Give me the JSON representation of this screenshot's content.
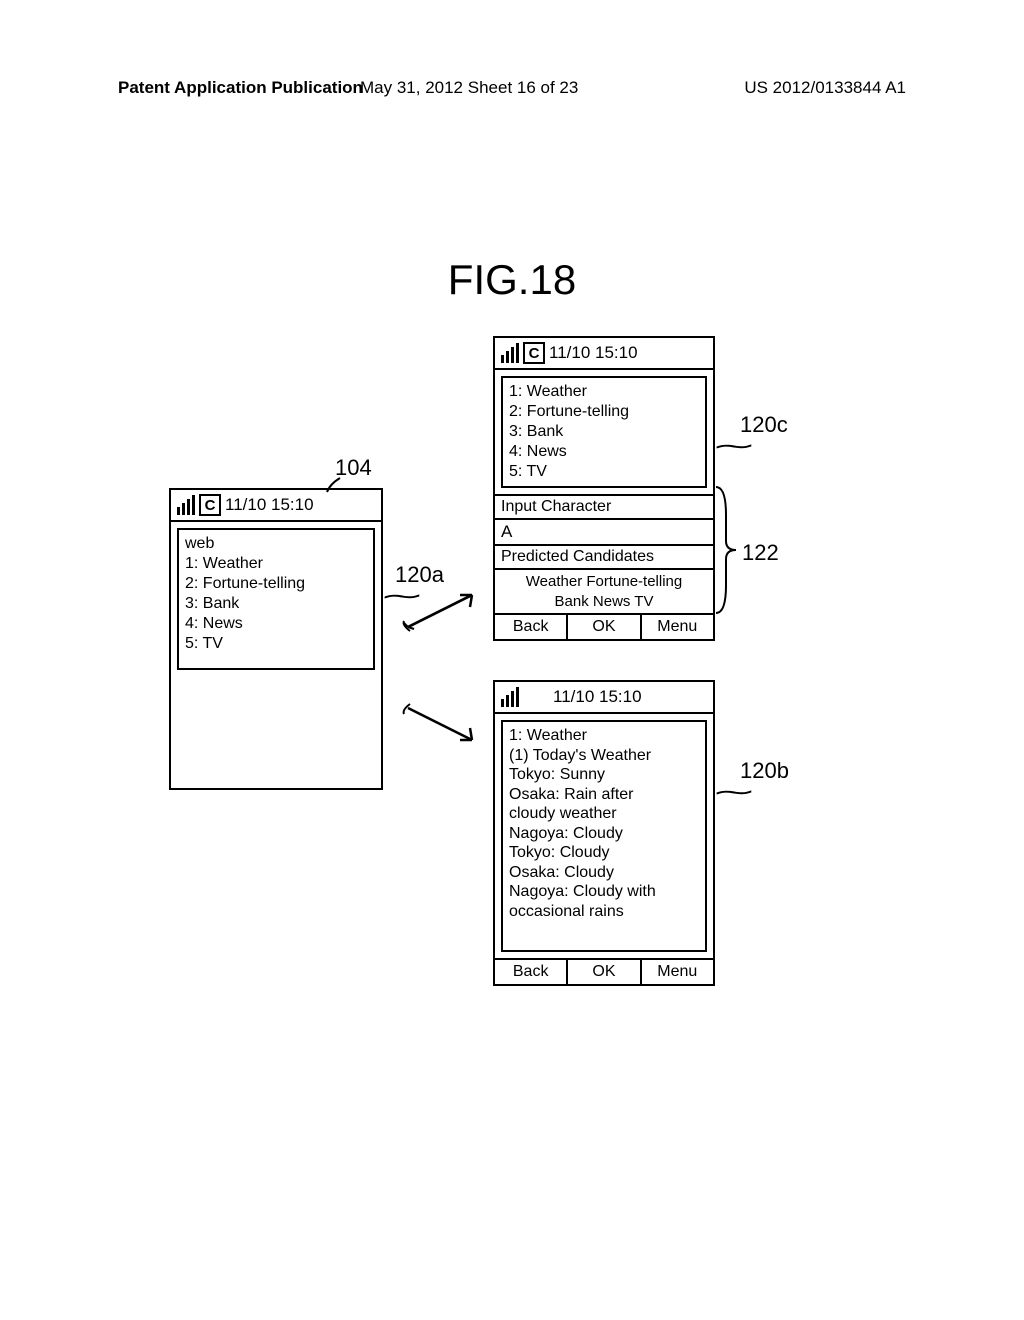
{
  "header": {
    "left": "Patent Application Publication",
    "center": "May 31, 2012  Sheet 16 of 23",
    "right": "US 2012/0133844 A1"
  },
  "figure_title": "FIG.18",
  "status_datetime": "11/10 15:10",
  "status_c": "C",
  "phone_left": {
    "web_label": "web",
    "items": {
      "i1": "1: Weather",
      "i2": "2: Fortune-telling",
      "i3": "3: Bank",
      "i4": "4: News",
      "i5": "5: TV"
    }
  },
  "phone_top_right": {
    "items": {
      "i1": "1: Weather",
      "i2": "2: Fortune-telling",
      "i3": "3: Bank",
      "i4": "4: News",
      "i5": "5: TV"
    },
    "input_label": "Input Character",
    "input_value": "A",
    "predicted_label": "Predicted Candidates",
    "predicted_line1": "Weather Fortune-telling",
    "predicted_line2": "Bank News TV"
  },
  "phone_bottom_right": {
    "line1": "1: Weather",
    "line2": "(1) Today's Weather",
    "line3": "Tokyo: Sunny",
    "line4": "Osaka: Rain after",
    "line5": "cloudy weather",
    "line6": "Nagoya: Cloudy",
    "line7": "Tokyo: Cloudy",
    "line8": "Osaka: Cloudy",
    "line9": "Nagoya: Cloudy with",
    "line10": "occasional rains"
  },
  "softkeys": {
    "back": "Back",
    "ok": "OK",
    "menu": "Menu"
  },
  "refs": {
    "r104": "104",
    "r120a": "120a",
    "r120b": "120b",
    "r120c": "120c",
    "r122": "122"
  }
}
